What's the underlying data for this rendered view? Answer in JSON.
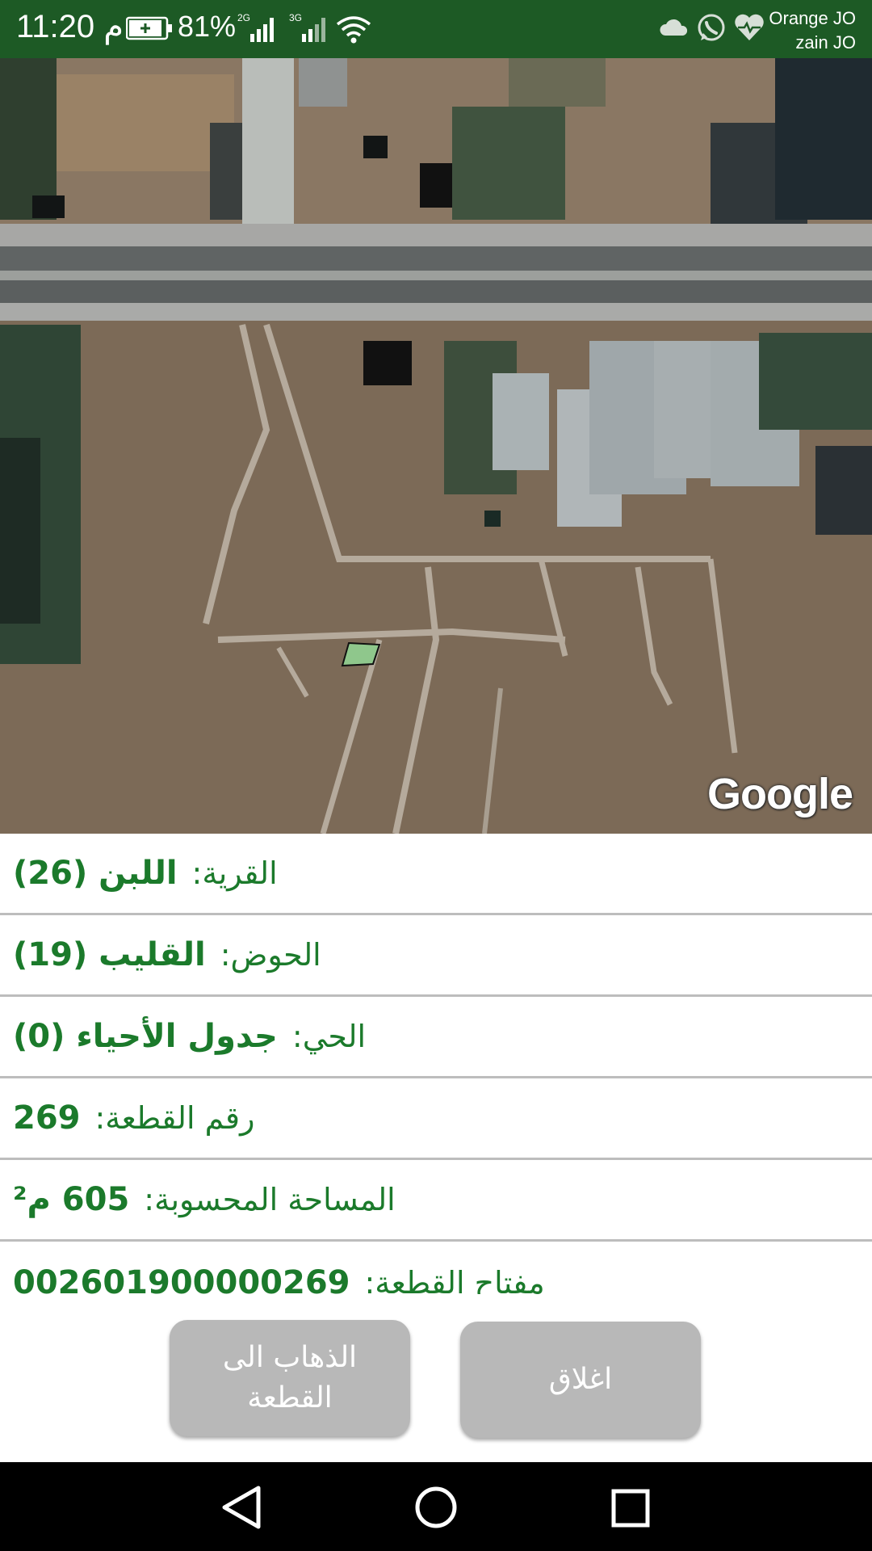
{
  "status_bar": {
    "time": "11:20 م",
    "battery_percent": "81%",
    "signal1_label": "2G",
    "signal2_label": "3G",
    "carrier1": "Orange JO",
    "carrier2": "zain JO",
    "icons": [
      "battery-icon",
      "signal-icon",
      "wifi-icon",
      "cloud-icon",
      "whatsapp-icon",
      "heart-icon"
    ]
  },
  "map": {
    "attribution": "Google"
  },
  "parcel_info": {
    "rows": [
      {
        "label": "القرية:",
        "value": "اللبن (26)"
      },
      {
        "label": "الحوض:",
        "value": "القليب (19)"
      },
      {
        "label": "الحي:",
        "value": "جدول الأحياء (0)"
      },
      {
        "label": "رقم القطعة:",
        "value": "269"
      },
      {
        "label": "المساحة المحسوبة:",
        "value": "605 م²"
      },
      {
        "label": "مفتاح القطعة:",
        "value": "002601900000269"
      }
    ]
  },
  "buttons": {
    "goto_line1": "الذهاب الى",
    "goto_line2": "القطعة",
    "close": "اغلاق"
  },
  "colors": {
    "status_bar": "#1d5a25",
    "accent_text": "#1b7a2b",
    "button_bg": "#b8b8b8"
  }
}
